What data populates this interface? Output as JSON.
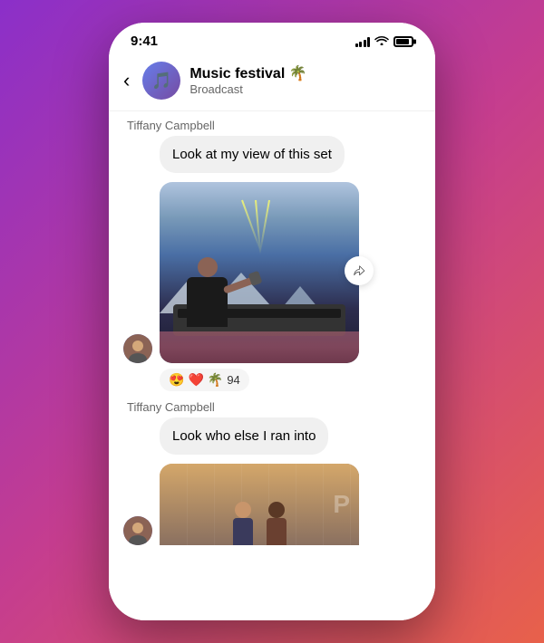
{
  "status": {
    "time": "9:41"
  },
  "header": {
    "back_label": "‹",
    "group_name": "Music festival 🌴",
    "group_type": "Broadcast",
    "avatar_emoji": "🎵"
  },
  "messages": [
    {
      "id": "msg1",
      "sender": "Tiffany Campbell",
      "text": "Look at my view of this set",
      "reactions": "😍 ❤️ 🌴 94"
    },
    {
      "id": "msg2",
      "sender": "Tiffany Campbell",
      "text": "Look who else I ran into"
    }
  ]
}
